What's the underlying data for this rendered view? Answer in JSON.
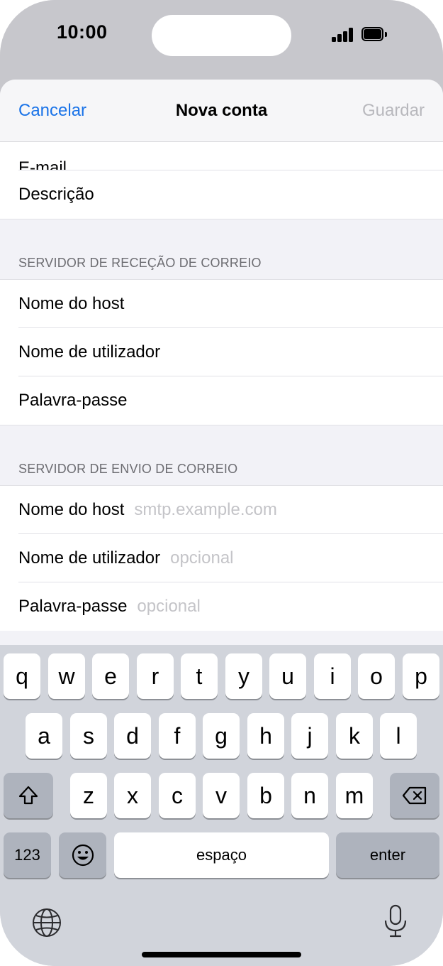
{
  "status_bar": {
    "time": "10:00"
  },
  "nav": {
    "cancel_label": "Cancelar",
    "title": "Nova conta",
    "save_label": "Guardar"
  },
  "account": {
    "rows": [
      {
        "label": "E-mail"
      },
      {
        "label": "Descrição"
      }
    ]
  },
  "incoming": {
    "header": "SERVIDOR DE RECEÇÃO DE CORREIO",
    "rows": [
      {
        "label": "Nome do host"
      },
      {
        "label": "Nome de utilizador"
      },
      {
        "label": "Palavra-passe"
      }
    ]
  },
  "outgoing": {
    "header": "SERVIDOR DE ENVIO DE CORREIO",
    "rows": [
      {
        "label": "Nome do host",
        "placeholder": "smtp.example.com"
      },
      {
        "label": "Nome de utilizador",
        "placeholder": "opcional"
      },
      {
        "label": "Palavra-passe",
        "placeholder": "opcional"
      }
    ]
  },
  "keyboard": {
    "row1": [
      "q",
      "w",
      "e",
      "r",
      "t",
      "y",
      "u",
      "i",
      "o",
      "p"
    ],
    "row2": [
      "a",
      "s",
      "d",
      "f",
      "g",
      "h",
      "j",
      "k",
      "l"
    ],
    "row3": [
      "z",
      "x",
      "c",
      "v",
      "b",
      "n",
      "m"
    ],
    "numbers_label": "123",
    "space_label": "espaço",
    "enter_label": "enter",
    "icons": {
      "shift": "shift-icon",
      "delete": "delete-icon",
      "emoji": "emoji-icon",
      "globe": "globe-icon",
      "mic": "microphone-icon"
    }
  },
  "colors": {
    "accent": "#1a73e8",
    "disabled": "#b8b8bd",
    "keyboard_bg": "#d1d4db"
  }
}
